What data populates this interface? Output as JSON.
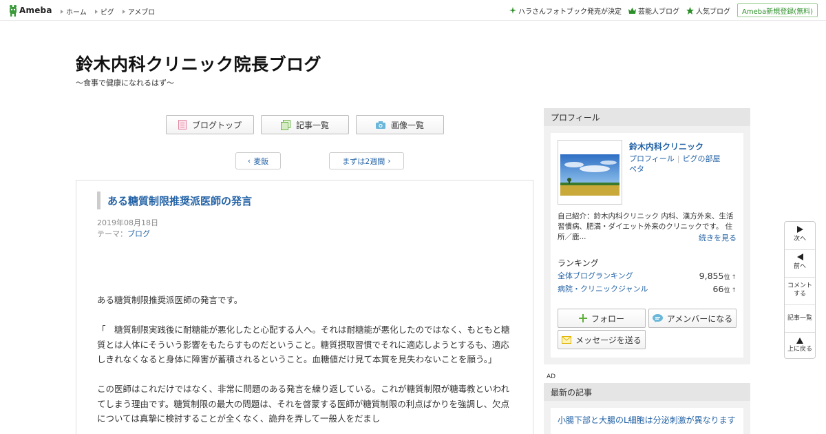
{
  "topbar": {
    "logo_text": "Ameba",
    "nav": [
      "ホーム",
      "ピグ",
      "アメブロ"
    ],
    "right_links": [
      {
        "label": "ハラさんフォトブック発売が決定",
        "icon": "sparkle-icon"
      },
      {
        "label": "芸能人ブログ",
        "icon": "crown-icon"
      },
      {
        "label": "人気ブログ",
        "icon": "star-icon"
      }
    ],
    "register_label": "Ameba新規登録(無料)"
  },
  "blog": {
    "title": "鈴木内科クリニック院長ブログ",
    "description": "～食事で健康になれるはず～"
  },
  "nav_buttons": [
    {
      "label": "ブログトップ",
      "icon": "document-icon"
    },
    {
      "label": "記事一覧",
      "icon": "copy-icon"
    },
    {
      "label": "画像一覧",
      "icon": "camera-icon"
    }
  ],
  "pager": {
    "prev_label": "麦飯",
    "next_label": "まずは2週間"
  },
  "article": {
    "title": "ある糖質制限推奨派医師の発言",
    "date": "2019年08月18日",
    "theme_prefix": "テーマ：",
    "theme": "ブログ",
    "paragraphs": [
      "ある糖質制限推奨派医師の発言です。",
      "「　糖質制限実践後に耐糖能が悪化したと心配する人へ。それは耐糖能が悪化したのではなく、もともと糖質とは人体にそういう影響をもたらすものだということ。糖質摂取習慣でそれに適応しようとするも、適応しきれなくなると身体に障害が蓄積されるということ。血糖値だけ見て本質を見失わないことを願う。」",
      "この医師はこれだけではなく、非常に問題のある発言を繰り返している。これが糖質制限が糖毒教といわれてしまう理由です。糖質制限の最大の問題は、それを啓蒙する医師が糖質制限の利点ばかりを強調し、欠点については真摯に検討することが全くなく、詭弁を弄して一般人をだまし"
    ]
  },
  "sidebar": {
    "profile_header": "プロフィール",
    "name": "鈴木内科クリニック",
    "link_profile": "プロフィール",
    "link_pigg": "ピグの部屋",
    "link_peta": "ペタ",
    "intro": "自己紹介：鈴木内科クリニック 内科、漢方外来、生活習慣病、肥満・ダイエット外来のクリニックです。 住所／鹿...",
    "more_label": "続きを見る",
    "ranking_label": "ランキング",
    "rankings": [
      {
        "label": "全体ブログランキング",
        "value": "9,855",
        "unit": "位",
        "arrow": "↑"
      },
      {
        "label": "病院・クリニックジャンル",
        "value": "66",
        "unit": "位",
        "arrow": "↑"
      }
    ],
    "follow_label": "フォロー",
    "amember_label": "アメンバーになる",
    "message_label": "メッセージを送る",
    "ad_label": "AD",
    "latest_header": "最新の記事",
    "latest_items": [
      "小腸下部と大腸のL細胞は分泌刺激が異なります"
    ]
  },
  "floatnav": {
    "next": "次へ",
    "prev": "前へ",
    "comment": "コメントする",
    "list": "記事一覧",
    "top": "上に戻る"
  },
  "colors": {
    "link": "#2463a6",
    "ameba_green": "#2d8f2a",
    "sidebar_header": "#e5e5e5"
  }
}
